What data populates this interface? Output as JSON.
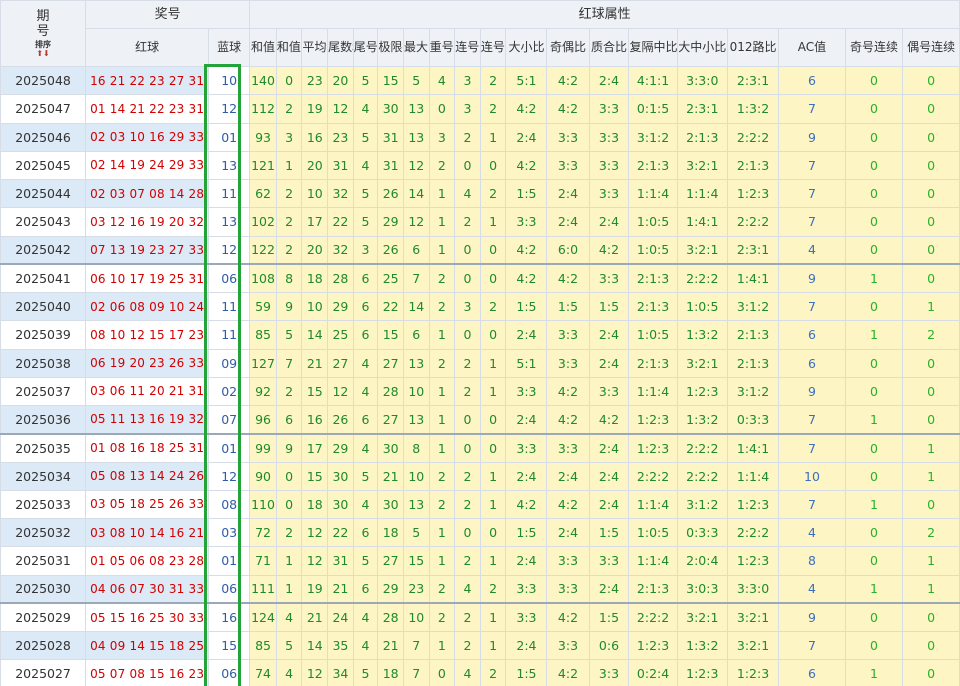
{
  "header": {
    "issue_label_line1": "期",
    "issue_label_line2": "号",
    "sort_label": "排序",
    "sort_arrows": "⬆⬇",
    "prize_group": "奖号",
    "attr_group": "红球属性",
    "red_label": "红球",
    "blue_label": "蓝球",
    "columns": [
      "和值",
      "和值尾数",
      "平均值",
      "尾数和值",
      "尾号组数",
      "极限间距",
      "最大间距",
      "重号个数",
      "连号个数",
      "连号组数",
      "大小比",
      "奇偶比",
      "质合比",
      "复隔中比",
      "大中小比",
      "012路比",
      "AC值",
      "奇号连续",
      "偶号连续"
    ]
  },
  "rows": [
    {
      "issue": "2025048",
      "red": "16 21 22 23 27 31",
      "blue": "10",
      "a": [
        "140",
        "0",
        "23",
        "20",
        "5",
        "15",
        "5",
        "4",
        "3",
        "2",
        "5:1",
        "4:2",
        "2:4",
        "4:1:1",
        "3:3:0",
        "2:3:1",
        "6",
        "0",
        "0"
      ]
    },
    {
      "issue": "2025047",
      "red": "01 14 21 22 23 31",
      "blue": "12",
      "a": [
        "112",
        "2",
        "19",
        "12",
        "4",
        "30",
        "13",
        "0",
        "3",
        "2",
        "4:2",
        "4:2",
        "3:3",
        "0:1:5",
        "2:3:1",
        "1:3:2",
        "7",
        "0",
        "0"
      ]
    },
    {
      "issue": "2025046",
      "red": "02 03 10 16 29 33",
      "blue": "01",
      "a": [
        "93",
        "3",
        "16",
        "23",
        "5",
        "31",
        "13",
        "3",
        "2",
        "1",
        "2:4",
        "3:3",
        "3:3",
        "3:1:2",
        "2:1:3",
        "2:2:2",
        "9",
        "0",
        "0"
      ]
    },
    {
      "issue": "2025045",
      "red": "02 14 19 24 29 33",
      "blue": "13",
      "a": [
        "121",
        "1",
        "20",
        "31",
        "4",
        "31",
        "12",
        "2",
        "0",
        "0",
        "4:2",
        "3:3",
        "3:3",
        "2:1:3",
        "3:2:1",
        "2:1:3",
        "7",
        "0",
        "0"
      ]
    },
    {
      "issue": "2025044",
      "red": "02 03 07 08 14 28",
      "blue": "11",
      "a": [
        "62",
        "2",
        "10",
        "32",
        "5",
        "26",
        "14",
        "1",
        "4",
        "2",
        "1:5",
        "2:4",
        "3:3",
        "1:1:4",
        "1:1:4",
        "1:2:3",
        "7",
        "0",
        "0"
      ]
    },
    {
      "issue": "2025043",
      "red": "03 12 16 19 20 32",
      "blue": "13",
      "a": [
        "102",
        "2",
        "17",
        "22",
        "5",
        "29",
        "12",
        "1",
        "2",
        "1",
        "3:3",
        "2:4",
        "2:4",
        "1:0:5",
        "1:4:1",
        "2:2:2",
        "7",
        "0",
        "0"
      ]
    },
    {
      "issue": "2025042",
      "red": "07 13 19 23 27 33",
      "blue": "12",
      "a": [
        "122",
        "2",
        "20",
        "32",
        "3",
        "26",
        "6",
        "1",
        "0",
        "0",
        "4:2",
        "6:0",
        "4:2",
        "1:0:5",
        "3:2:1",
        "2:3:1",
        "4",
        "0",
        "0"
      ]
    },
    {
      "issue": "2025041",
      "red": "06 10 17 19 25 31",
      "blue": "06",
      "a": [
        "108",
        "8",
        "18",
        "28",
        "6",
        "25",
        "7",
        "2",
        "0",
        "0",
        "4:2",
        "4:2",
        "3:3",
        "2:1:3",
        "2:2:2",
        "1:4:1",
        "9",
        "1",
        "0"
      ]
    },
    {
      "issue": "2025040",
      "red": "02 06 08 09 10 24",
      "blue": "11",
      "a": [
        "59",
        "9",
        "10",
        "29",
        "6",
        "22",
        "14",
        "2",
        "3",
        "2",
        "1:5",
        "1:5",
        "1:5",
        "2:1:3",
        "1:0:5",
        "3:1:2",
        "7",
        "0",
        "1"
      ]
    },
    {
      "issue": "2025039",
      "red": "08 10 12 15 17 23",
      "blue": "11",
      "a": [
        "85",
        "5",
        "14",
        "25",
        "6",
        "15",
        "6",
        "1",
        "0",
        "0",
        "2:4",
        "3:3",
        "2:4",
        "1:0:5",
        "1:3:2",
        "2:1:3",
        "6",
        "1",
        "2"
      ]
    },
    {
      "issue": "2025038",
      "red": "06 19 20 23 26 33",
      "blue": "09",
      "a": [
        "127",
        "7",
        "21",
        "27",
        "4",
        "27",
        "13",
        "2",
        "2",
        "1",
        "5:1",
        "3:3",
        "2:4",
        "2:1:3",
        "3:2:1",
        "2:1:3",
        "6",
        "0",
        "0"
      ]
    },
    {
      "issue": "2025037",
      "red": "03 06 11 20 21 31",
      "blue": "02",
      "a": [
        "92",
        "2",
        "15",
        "12",
        "4",
        "28",
        "10",
        "1",
        "2",
        "1",
        "3:3",
        "4:2",
        "3:3",
        "1:1:4",
        "1:2:3",
        "3:1:2",
        "9",
        "0",
        "0"
      ]
    },
    {
      "issue": "2025036",
      "red": "05 11 13 16 19 32",
      "blue": "07",
      "a": [
        "96",
        "6",
        "16",
        "26",
        "6",
        "27",
        "13",
        "1",
        "0",
        "0",
        "2:4",
        "4:2",
        "4:2",
        "1:2:3",
        "1:3:2",
        "0:3:3",
        "7",
        "1",
        "0"
      ]
    },
    {
      "issue": "2025035",
      "red": "01 08 16 18 25 31",
      "blue": "01",
      "a": [
        "99",
        "9",
        "17",
        "29",
        "4",
        "30",
        "8",
        "1",
        "0",
        "0",
        "3:3",
        "3:3",
        "2:4",
        "1:2:3",
        "2:2:2",
        "1:4:1",
        "7",
        "0",
        "1"
      ]
    },
    {
      "issue": "2025034",
      "red": "05 08 13 14 24 26",
      "blue": "12",
      "a": [
        "90",
        "0",
        "15",
        "30",
        "5",
        "21",
        "10",
        "2",
        "2",
        "1",
        "2:4",
        "2:4",
        "2:4",
        "2:2:2",
        "2:2:2",
        "1:1:4",
        "10",
        "0",
        "1"
      ]
    },
    {
      "issue": "2025033",
      "red": "03 05 18 25 26 33",
      "blue": "08",
      "a": [
        "110",
        "0",
        "18",
        "30",
        "4",
        "30",
        "13",
        "2",
        "2",
        "1",
        "4:2",
        "4:2",
        "2:4",
        "1:1:4",
        "3:1:2",
        "1:2:3",
        "7",
        "1",
        "0"
      ]
    },
    {
      "issue": "2025032",
      "red": "03 08 10 14 16 21",
      "blue": "03",
      "a": [
        "72",
        "2",
        "12",
        "22",
        "6",
        "18",
        "5",
        "1",
        "0",
        "0",
        "1:5",
        "2:4",
        "1:5",
        "1:0:5",
        "0:3:3",
        "2:2:2",
        "4",
        "0",
        "2"
      ]
    },
    {
      "issue": "2025031",
      "red": "01 05 06 08 23 28",
      "blue": "01",
      "a": [
        "71",
        "1",
        "12",
        "31",
        "5",
        "27",
        "15",
        "1",
        "2",
        "1",
        "2:4",
        "3:3",
        "3:3",
        "1:1:4",
        "2:0:4",
        "1:2:3",
        "8",
        "0",
        "1"
      ]
    },
    {
      "issue": "2025030",
      "red": "04 06 07 30 31 33",
      "blue": "06",
      "a": [
        "111",
        "1",
        "19",
        "21",
        "6",
        "29",
        "23",
        "2",
        "4",
        "2",
        "3:3",
        "3:3",
        "2:4",
        "2:1:3",
        "3:0:3",
        "3:3:0",
        "4",
        "1",
        "1"
      ]
    },
    {
      "issue": "2025029",
      "red": "05 15 16 25 30 33",
      "blue": "16",
      "a": [
        "124",
        "4",
        "21",
        "24",
        "4",
        "28",
        "10",
        "2",
        "2",
        "1",
        "3:3",
        "4:2",
        "1:5",
        "2:2:2",
        "3:2:1",
        "3:2:1",
        "9",
        "0",
        "0"
      ]
    },
    {
      "issue": "2025028",
      "red": "04 09 14 15 18 25",
      "blue": "15",
      "a": [
        "85",
        "5",
        "14",
        "35",
        "4",
        "21",
        "7",
        "1",
        "2",
        "1",
        "2:4",
        "3:3",
        "0:6",
        "1:2:3",
        "1:3:2",
        "3:2:1",
        "7",
        "0",
        "0"
      ]
    },
    {
      "issue": "2025027",
      "red": "05 07 08 15 16 23",
      "blue": "06",
      "a": [
        "74",
        "4",
        "12",
        "34",
        "5",
        "18",
        "7",
        "0",
        "4",
        "2",
        "1:5",
        "4:2",
        "3:3",
        "0:2:4",
        "1:2:3",
        "1:2:3",
        "6",
        "1",
        "0"
      ]
    }
  ]
}
